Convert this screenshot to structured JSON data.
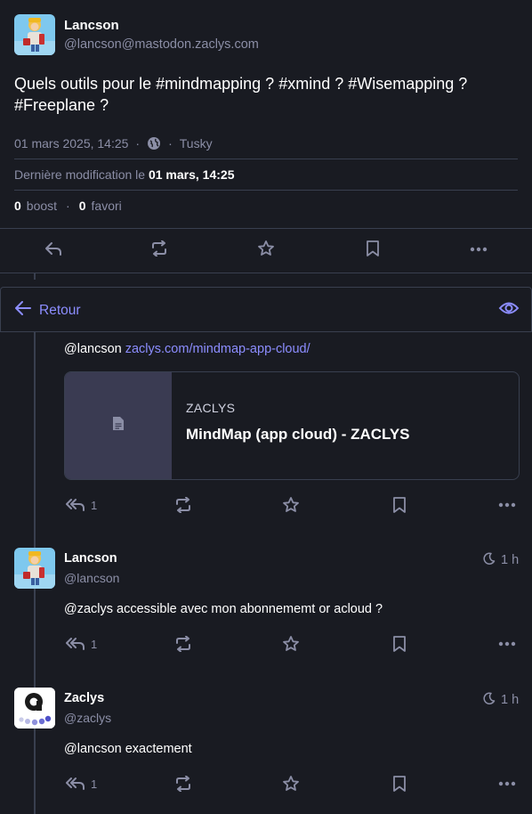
{
  "main_post": {
    "display_name": "Lancson",
    "handle": "@lancson@mastodon.zaclys.com",
    "content_prefix": "Quels outils pour le ",
    "hashtags": [
      "#mindmapping",
      "#xmind",
      "#Wisemapping",
      "#Freeplane"
    ],
    "date": "01 mars 2025, 14:25",
    "client": "Tusky",
    "edited_label": "Dernière modification le",
    "edited_date": "01 mars, 14:25",
    "boost_count": "0",
    "boost_label": "boost",
    "fav_count": "0",
    "fav_label": "favori"
  },
  "nav": {
    "back_label": "Retour"
  },
  "replies": [
    {
      "mention": "@lancson",
      "link": "zaclys.com/mindmap-app-cloud/",
      "card": {
        "provider": "ZACLYS",
        "title": "MindMap (app cloud) - ZACLYS"
      },
      "reply_count": "1"
    },
    {
      "display_name": "Lancson",
      "handle": "@lancson",
      "time": "1 h",
      "mention": "@zaclys",
      "text": " accessible avec mon abonnememt or acloud ?",
      "reply_count": "1"
    },
    {
      "display_name": "Zaclys",
      "handle": "@zaclys",
      "time": "1 h",
      "mention": "@lancson",
      "text": " exactement",
      "reply_count": "1"
    }
  ],
  "colors": {
    "background": "#191b22",
    "accent": "#8c8dff",
    "muted": "#8b8ea6",
    "border": "#393f4f"
  }
}
